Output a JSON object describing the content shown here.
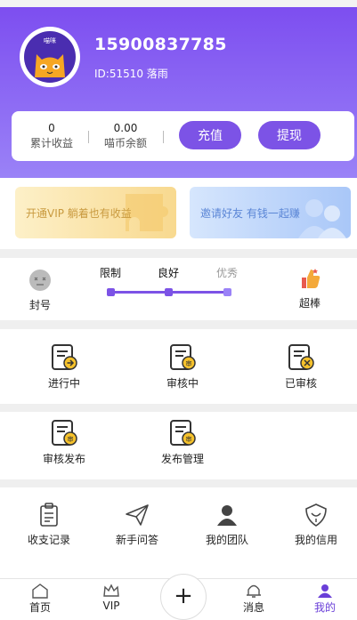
{
  "profile": {
    "phone": "15900837785",
    "id_line": "ID:51510 落雨",
    "avatar_text": "喵咪"
  },
  "stats": {
    "earnings_value": "0",
    "earnings_label": "累计收益",
    "balance_value": "0.00",
    "balance_label": "喵币余额",
    "recharge_label": "充值",
    "withdraw_label": "提现"
  },
  "promo": {
    "vip_text": "开通VIP 躺着也有收益",
    "invite_text": "邀请好友 有钱一起赚"
  },
  "reputation": {
    "left_label": "封号",
    "levels": [
      "限制",
      "良好",
      "优秀"
    ],
    "right_label": "超棒"
  },
  "tasks": {
    "row1": [
      "进行中",
      "审核中",
      "已审核"
    ],
    "row2": [
      "审核发布",
      "发布管理"
    ]
  },
  "tools": [
    "收支记录",
    "新手问答",
    "我的团队",
    "我的信用"
  ],
  "tabbar": {
    "home": "首页",
    "vip": "VIP",
    "plus": "+",
    "messages": "消息",
    "mine": "我的"
  },
  "colors": {
    "accent": "#7c53e6",
    "vip_card": "#fde7b3",
    "invite_card": "#b9d3fb",
    "active_tab": "#6a3fd8"
  }
}
